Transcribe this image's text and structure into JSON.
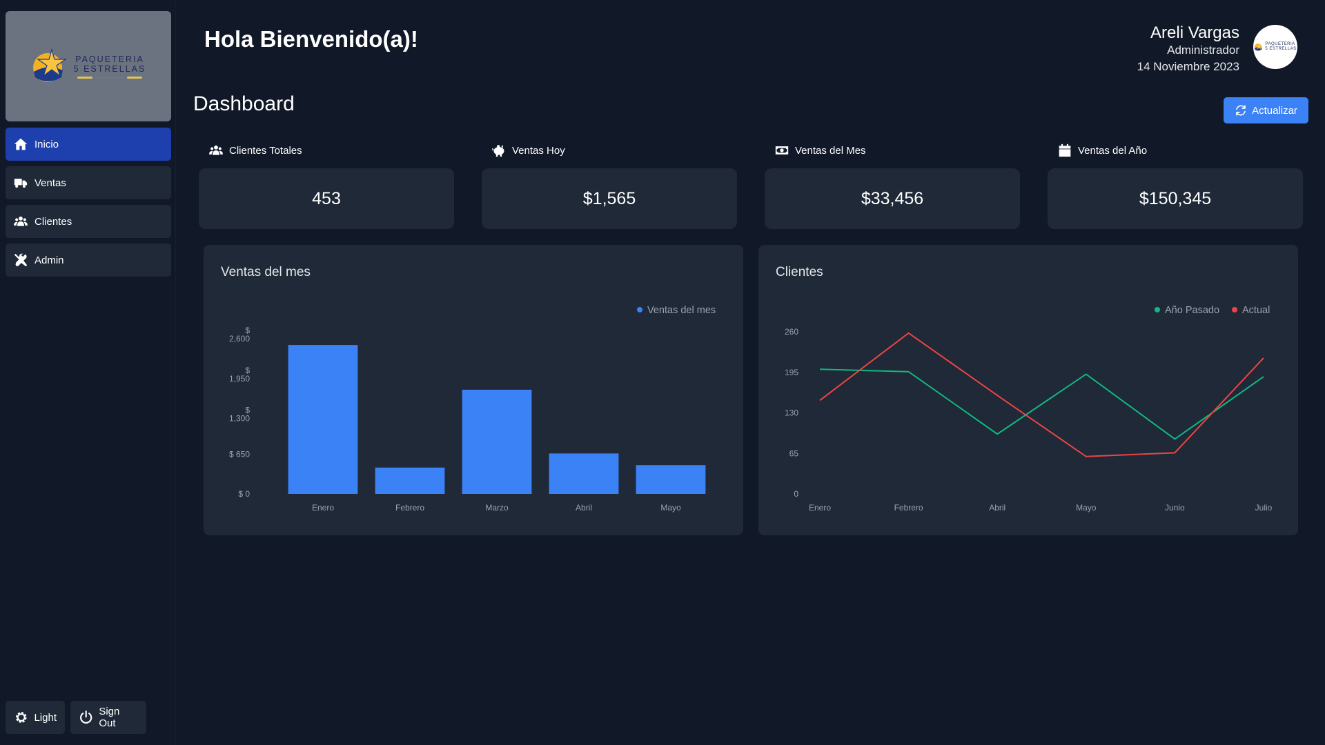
{
  "logo": {
    "line1": "PAQUETERIA",
    "line2": "5 ESTRELLAS"
  },
  "sidebar": {
    "items": [
      {
        "label": "Inicio",
        "icon": "home-icon",
        "active": true
      },
      {
        "label": "Ventas",
        "icon": "truck-icon",
        "active": false
      },
      {
        "label": "Clientes",
        "icon": "users-icon",
        "active": false
      },
      {
        "label": "Admin",
        "icon": "tools-icon",
        "active": false
      }
    ],
    "theme_label": "Light",
    "signout_label": "Sign Out"
  },
  "header": {
    "greeting": "Hola Bienvenido(a)!",
    "user_name": "Areli Vargas",
    "user_role": "Administrador",
    "date": "14 Noviembre 2023"
  },
  "page": {
    "title": "Dashboard",
    "refresh_label": "Actualizar"
  },
  "stats": [
    {
      "label": "Clientes Totales",
      "value": "453",
      "icon": "users-icon"
    },
    {
      "label": "Ventas Hoy",
      "value": "$1,565",
      "icon": "piggy-bank-icon"
    },
    {
      "label": "Ventas del Mes",
      "value": "$33,456",
      "icon": "money-bill-icon"
    },
    {
      "label": "Ventas del Año",
      "value": "$150,345",
      "icon": "calendar-icon"
    }
  ],
  "colors": {
    "background": "#111827",
    "card": "#1f2937",
    "active_nav": "#1e40af",
    "accent": "#3b82f6",
    "line_previous": "#10b981",
    "line_current": "#ef4444"
  },
  "chart_data": [
    {
      "type": "bar",
      "title": "Ventas del mes",
      "categories": [
        "Enero",
        "Febrero",
        "Marzo",
        "Abril",
        "Mayo"
      ],
      "series": [
        {
          "name": "Ventas del mes",
          "values": [
            2430,
            430,
            1700,
            660,
            470
          ],
          "color": "#3b82f6"
        }
      ],
      "ylim": [
        0,
        2600
      ],
      "yticks": [
        0,
        650,
        1300,
        1950,
        2600
      ],
      "ytick_labels": [
        "$ 0",
        "$ 650",
        "$\n1,300",
        "$\n1,950",
        "$\n2,600"
      ],
      "legend": "top-right",
      "grid": false
    },
    {
      "type": "line",
      "title": "Clientes",
      "categories": [
        "Enero",
        "Febrero",
        "Abril",
        "Mayo",
        "Junio",
        "Julio"
      ],
      "series": [
        {
          "name": "Año Pasado",
          "values": [
            200,
            196,
            96,
            192,
            88,
            188
          ],
          "color": "#10b981"
        },
        {
          "name": "Actual",
          "values": [
            150,
            258,
            158,
            60,
            66,
            218
          ],
          "color": "#ef4444"
        }
      ],
      "ylim": [
        0,
        260
      ],
      "yticks": [
        0,
        65,
        130,
        195,
        260
      ],
      "ytick_labels": [
        "0",
        "65",
        "130",
        "195",
        "260"
      ],
      "legend": "top-right",
      "grid": false
    }
  ]
}
